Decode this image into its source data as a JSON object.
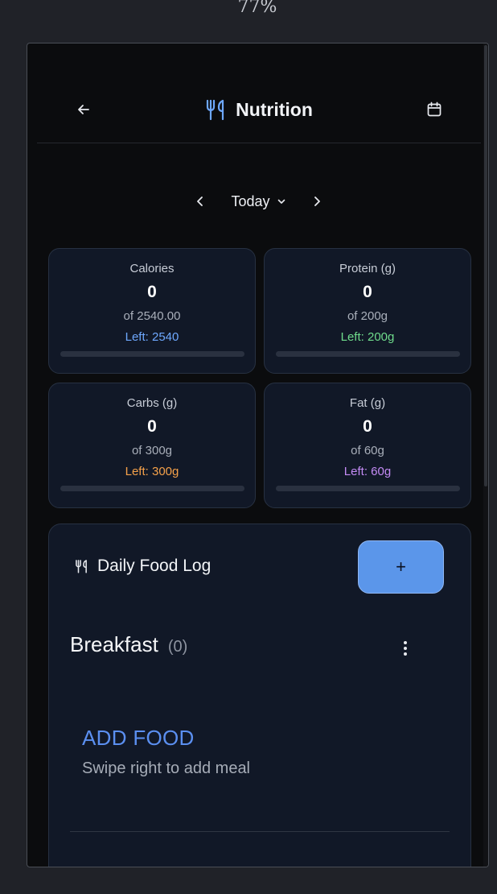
{
  "zoom": "77%",
  "header": {
    "back_icon": "arrow-left-icon",
    "app_icon": "utensils-icon",
    "title": "Nutrition",
    "calendar_icon": "calendar-icon"
  },
  "date_nav": {
    "label": "Today",
    "prev_icon": "chevron-left-icon",
    "next_icon": "chevron-right-icon",
    "dropdown_icon": "chevron-down-icon"
  },
  "macros": [
    {
      "label": "Calories",
      "value": "0",
      "of": "of 2540.00",
      "left": "Left: 2540",
      "color": "#6ea8fe",
      "progress": 0
    },
    {
      "label": "Protein (g)",
      "value": "0",
      "of": "of 200g",
      "left": "Left: 200g",
      "color": "#6fdc8c",
      "progress": 0
    },
    {
      "label": "Carbs (g)",
      "value": "0",
      "of": "of 300g",
      "left": "Left: 300g",
      "color": "#f5a14a",
      "progress": 0
    },
    {
      "label": "Fat (g)",
      "value": "0",
      "of": "of 60g",
      "left": "Left: 60g",
      "color": "#c48bf5",
      "progress": 0
    }
  ],
  "food_log": {
    "icon": "utensils-icon",
    "title": "Daily Food Log",
    "add_label": "+",
    "meal": {
      "name": "Breakfast",
      "count": "(0)",
      "menu_icon": "more-vertical-icon",
      "add_food": "ADD FOOD",
      "hint": "Swipe right to add meal"
    }
  }
}
